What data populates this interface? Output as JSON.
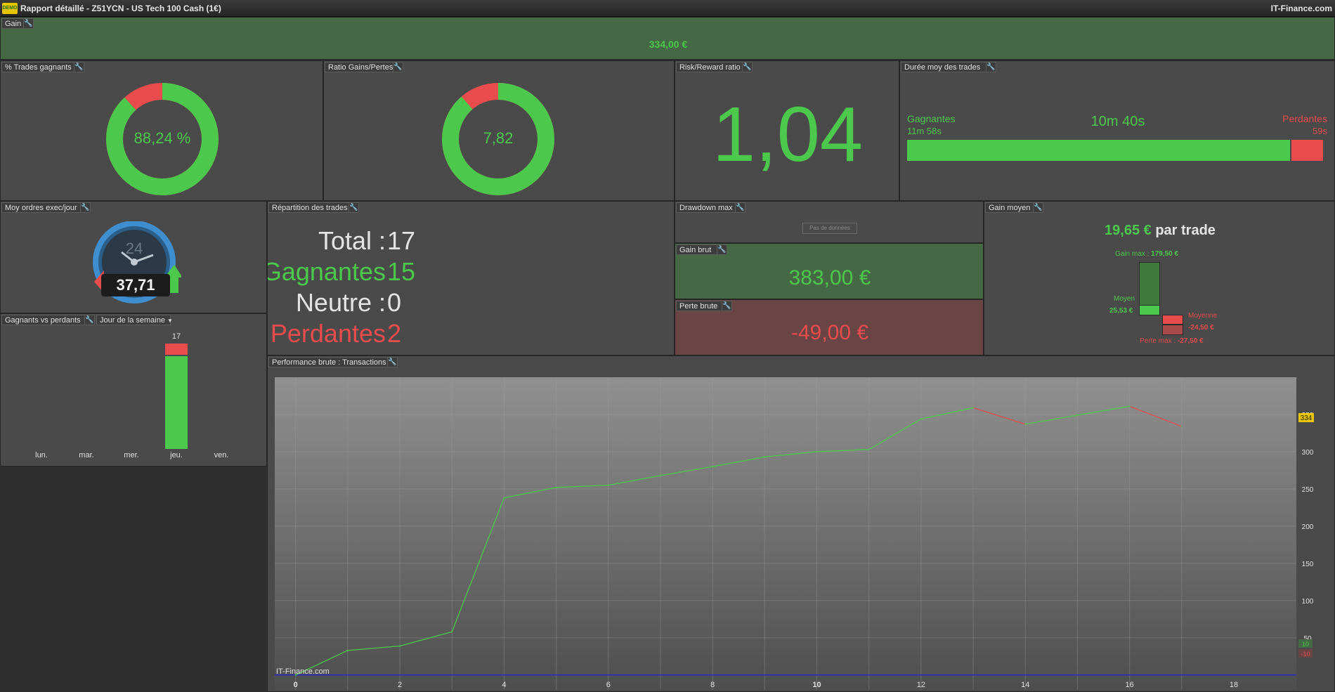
{
  "window": {
    "logo": "DEMO",
    "title": "Rapport détaillé - Z51YCN - US Tech 100 Cash (1€)",
    "brand": "IT-Finance.com"
  },
  "gain": {
    "title": "Gain",
    "value": "334,00 €"
  },
  "winrate": {
    "title": "% Trades gagnants",
    "value": "88,24 %",
    "fraction": 0.8824
  },
  "ratio": {
    "title": "Ratio Gains/Pertes",
    "value": "7,82",
    "fraction": 0.8866
  },
  "risk": {
    "title": "Risk/Reward ratio",
    "value": "1,04"
  },
  "duration": {
    "title": "Durée moy des trades",
    "winners_label": "Gagnantes",
    "winners_value": "11m 58s",
    "average": "10m 40s",
    "losers_label": "Perdantes",
    "losers_value": "59s",
    "win_fraction": 0.924
  },
  "orders": {
    "title": "Moy ordres exec/jour",
    "clock_number": "24",
    "value": "37,71"
  },
  "distribution": {
    "title": "Répartition des trades",
    "total_label": "Total :",
    "total": "17",
    "win_label": "Gagnantes :",
    "win": "15",
    "neutral_label": "Neutre :",
    "neutral": "0",
    "loss_label": "Perdantes :",
    "loss": "2"
  },
  "drawdown": {
    "title": "Drawdown max",
    "no_data": "Pas de données"
  },
  "gross_gain": {
    "title": "Gain brut",
    "value": "383,00 €"
  },
  "gross_loss": {
    "title": "Perte brute",
    "value": "-49,00 €"
  },
  "avg_gain": {
    "title": "Gain moyen",
    "value": "19,65 €",
    "suffix": "par trade",
    "max_gain_label": "Gain max :",
    "max_gain": "179,50 €",
    "avg_win_label": "Moyen",
    "avg_win": "25,53 €",
    "avg_loss_label": "Moyenne",
    "avg_loss": "-24,50 €",
    "max_loss_label": "Perte max :",
    "max_loss": "-27,50 €"
  },
  "winners_losers": {
    "title": "Gagnants vs perdants",
    "selector": "Jour de la semaine",
    "days": [
      "lun.",
      "mar.",
      "mer.",
      "jeu.",
      "ven."
    ],
    "counts": [
      0,
      0,
      0,
      17,
      0
    ],
    "wins": [
      0,
      0,
      0,
      15,
      0
    ],
    "losses": [
      0,
      0,
      0,
      2,
      0
    ]
  },
  "performance": {
    "title": "Performance brute : Transactions",
    "watermark": "IT-Finance.com",
    "last_badge": "334",
    "zero_badge_pos": "10",
    "zero_badge_neg": "-10"
  },
  "colors": {
    "green": "#4cc94c",
    "red": "#e84c4c",
    "panel": "#4a4a4a",
    "zero_line": "#2828c8"
  },
  "chart_data": {
    "type": "line",
    "title": "Performance brute : Transactions",
    "x": [
      0,
      1,
      2,
      3,
      4,
      5,
      6,
      7,
      8,
      9,
      10,
      11,
      12,
      13,
      14,
      15,
      16,
      17
    ],
    "y": [
      0,
      33,
      39,
      58,
      238,
      252,
      255,
      268,
      280,
      293,
      300,
      303,
      344,
      359,
      337,
      349,
      361,
      334
    ],
    "segment_colors": [
      "green",
      "green",
      "green",
      "green",
      "green",
      "green",
      "green",
      "green",
      "green",
      "green",
      "green",
      "green",
      "green",
      "red",
      "green",
      "green",
      "red"
    ],
    "xlim": [
      -0.4,
      19.2
    ],
    "ylim": [
      -20,
      400
    ],
    "xticks": [
      0,
      2,
      4,
      6,
      8,
      10,
      12,
      14,
      16,
      18
    ],
    "yticks": [
      50,
      100,
      150,
      200,
      250,
      300,
      350
    ],
    "grid": true
  }
}
